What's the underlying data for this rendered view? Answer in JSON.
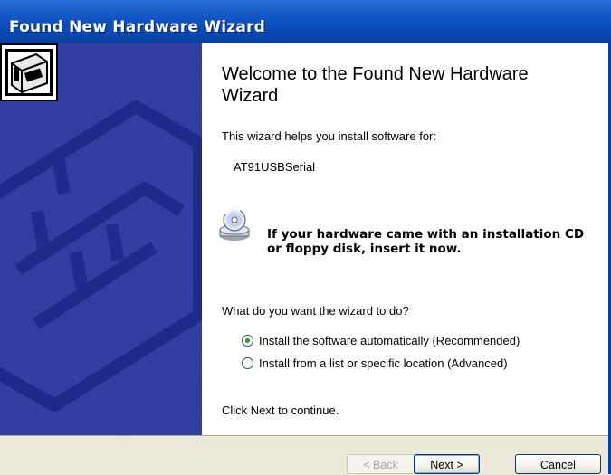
{
  "window": {
    "title": "Found New Hardware Wizard"
  },
  "content": {
    "heading": "Welcome to the Found New Hardware Wizard",
    "intro": "This wizard helps you install software for:",
    "device_name": "AT91USBSerial",
    "cd_notice": "If your hardware came with an installation CD or floppy disk, insert it now.",
    "question": "What do you want the wizard to do?",
    "options": [
      {
        "label": "Install the software automatically (Recommended)",
        "selected": true
      },
      {
        "label": "Install from a list or specific location (Advanced)",
        "selected": false
      }
    ],
    "footer_hint": "Click Next to continue."
  },
  "buttons": {
    "back": "< Back",
    "next": "Next >",
    "cancel": "Cancel"
  },
  "icons": {
    "hardware": "hardware-wizard-icon",
    "cd": "cd-install-icon"
  },
  "colors": {
    "titlebar": "#0b4fbe",
    "side_panel": "#2d3aa0",
    "dialog_bg": "#ece9d8",
    "radio_selected": "#21a121"
  }
}
